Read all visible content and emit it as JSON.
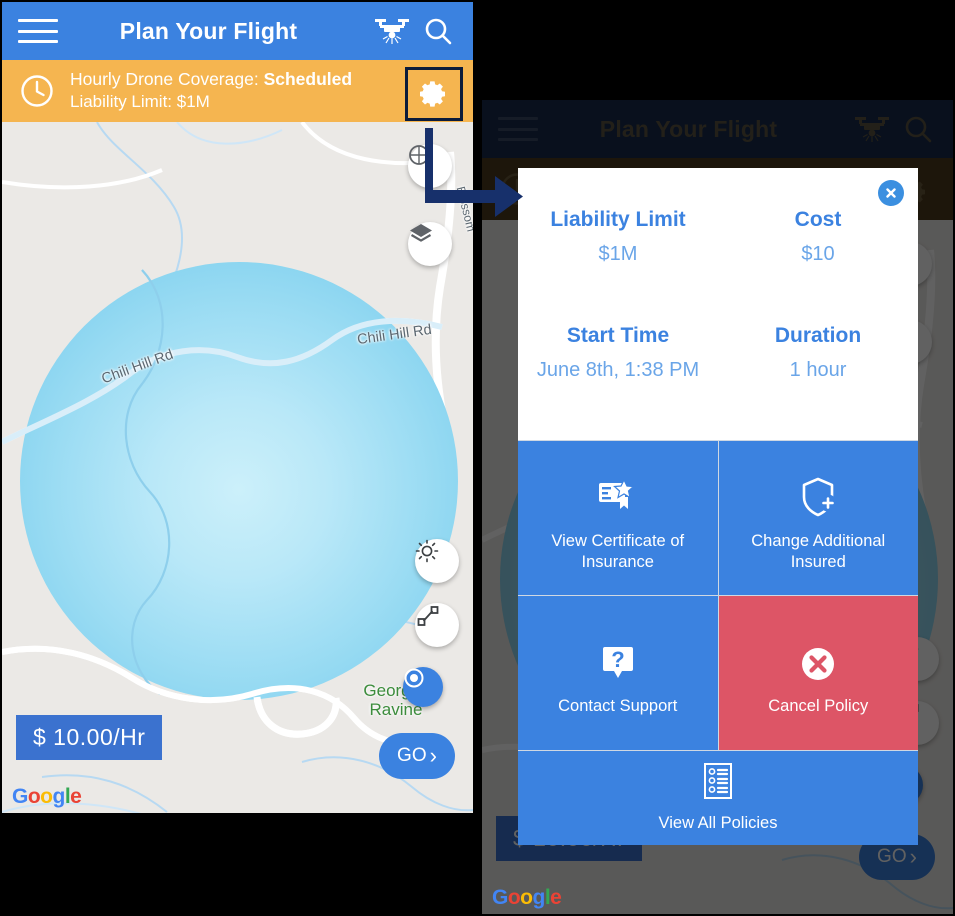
{
  "app": {
    "title": "Plan Your Flight",
    "menu_icon": "hamburger-menu-icon",
    "drone_icon": "drone-icon",
    "search_icon": "search-icon"
  },
  "status_banner": {
    "clock_icon": "clock-icon",
    "coverage_prefix": "Hourly Drone Coverage: ",
    "coverage_status": "Scheduled",
    "liability_line": "Liability Limit: $1M",
    "settings_icon": "gear-icon",
    "bg_color": "#f5b550"
  },
  "map": {
    "road_label_1": "Chili Hill Rd",
    "road_label_2": "Chili Hill Rd",
    "road_label_3": "Blossom",
    "place_label_line1": "Georges",
    "place_label_line2": "Ravine",
    "controls": [
      {
        "name": "compass-icon"
      },
      {
        "name": "layers-icon"
      },
      {
        "name": "brightness-icon"
      },
      {
        "name": "route-path-icon"
      },
      {
        "name": "my-location-icon"
      }
    ],
    "price_badge": "$ 10.00/Hr",
    "go_button": "GO",
    "go_chevron": "›",
    "watermark": [
      "G",
      "o",
      "o",
      "g",
      "l",
      "e"
    ],
    "coverage_circle_color": "#9bdcf3"
  },
  "modal": {
    "close_icon": "close-icon",
    "fields": [
      {
        "label": "Liability Limit",
        "value": "$1M"
      },
      {
        "label": "Cost",
        "value": "$10"
      },
      {
        "label": "Start Time",
        "value": "June 8th, 1:38 PM"
      },
      {
        "label": "Duration",
        "value": "1 hour"
      }
    ],
    "actions": [
      {
        "label": "View Certificate of Insurance",
        "icon": "certificate-icon",
        "color": "#3b82e0"
      },
      {
        "label": "Change Additional Insured",
        "icon": "shield-plus-icon",
        "color": "#3b82e0"
      },
      {
        "label": "Contact Support",
        "icon": "question-bubble-icon",
        "color": "#3b82e0"
      },
      {
        "label": "Cancel Policy",
        "icon": "cancel-circle-icon",
        "color": "#dd5566"
      },
      {
        "label": "View All Policies",
        "icon": "policy-list-icon",
        "color": "#3b82e0"
      }
    ],
    "accent_color": "#3b82e0",
    "danger_color": "#dd5566"
  },
  "annotation": {
    "arrow_icon": "flow-arrow-icon",
    "arrow_color": "#17306b"
  }
}
